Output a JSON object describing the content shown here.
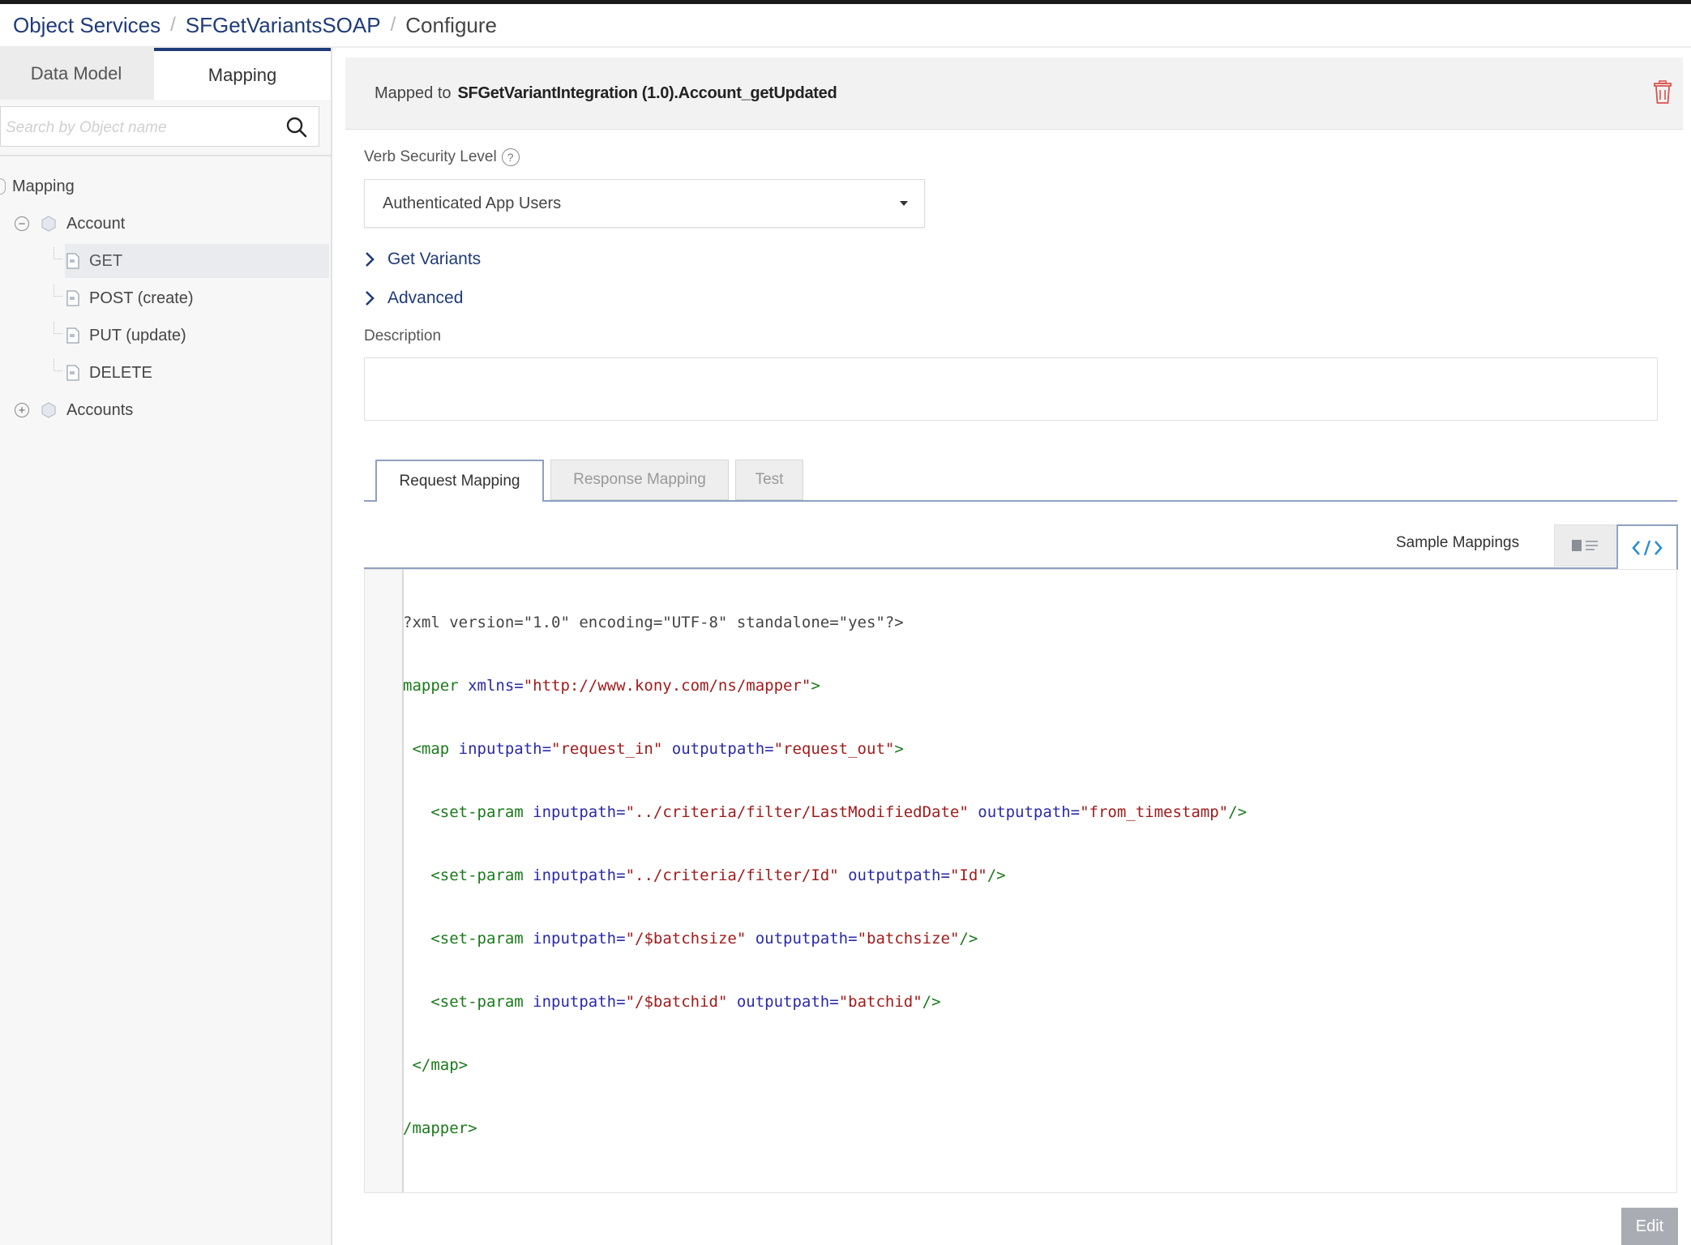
{
  "breadcrumb": {
    "items": [
      "Object Services",
      "SFGetVariantsSOAP",
      "Configure"
    ],
    "separator": "/"
  },
  "sidebar": {
    "tabs": {
      "data_model": "Data Model",
      "mapping": "Mapping"
    },
    "search_placeholder": "Search by Object name",
    "tree": {
      "root": "Mapping",
      "account": "Account",
      "verbs": [
        "GET",
        "POST (create)",
        "PUT (update)",
        "DELETE"
      ],
      "accounts": "Accounts"
    }
  },
  "main": {
    "mapped_prefix": "Mapped to",
    "mapped_target": "SFGetVariantIntegration (1.0).Account_getUpdated",
    "verb_security_label": "Verb Security Level",
    "help_glyph": "?",
    "security_value": "Authenticated App Users",
    "sections": [
      "Get Variants",
      "Advanced"
    ],
    "description_label": "Description",
    "tabs": [
      "Request Mapping",
      "Response Mapping",
      "Test"
    ],
    "sample_mappings": "Sample Mappings",
    "edit_label": "Edit"
  },
  "code": {
    "l1": "?xml version=\"1.0\" encoding=\"UTF-8\" standalone=\"yes\"?>",
    "l2": {
      "tag": "mapper",
      "attr": " xmlns=",
      "str": "\"http://www.kony.com/ns/mapper\"",
      "end": ">"
    },
    "l3": {
      "tag": " <map",
      "attr1": " inputpath=",
      "str1": "\"request_in\"",
      "attr2": " outputpath=",
      "str2": "\"request_out\"",
      "end": ">"
    },
    "l4": {
      "tag": "   <set-param",
      "attr1": " inputpath=",
      "str1": "\"../criteria/filter/LastModifiedDate\"",
      "attr2": " outputpath=",
      "str2": "\"from_timestamp\"",
      "end": "/>"
    },
    "l5": {
      "tag": "   <set-param",
      "attr1": " inputpath=",
      "str1": "\"../criteria/filter/Id\"",
      "attr2": " outputpath=",
      "str2": "\"Id\"",
      "end": "/>"
    },
    "l6": {
      "tag": "   <set-param",
      "attr1": " inputpath=",
      "str1": "\"/$batchsize\"",
      "attr2": " outputpath=",
      "str2": "\"batchsize\"",
      "end": "/>"
    },
    "l7": {
      "tag": "   <set-param",
      "attr1": " inputpath=",
      "str1": "\"/$batchid\"",
      "attr2": " outputpath=",
      "str2": "\"batchid\"",
      "end": "/>"
    },
    "l8": " </map>",
    "l9": "/mapper>"
  },
  "colors": {
    "brand": "#1f3b78",
    "tag": "#1a7a1a",
    "attr": "#2a2aa8",
    "string": "#a11b1b",
    "delete": "#d9534f"
  },
  "icons": {
    "search": "search-icon",
    "trash": "trash-icon",
    "chevron": "chevron-right-icon",
    "object": "object-icon",
    "verb": "verb-icon",
    "list_view": "list-view-icon",
    "code_view": "code-view-icon"
  }
}
